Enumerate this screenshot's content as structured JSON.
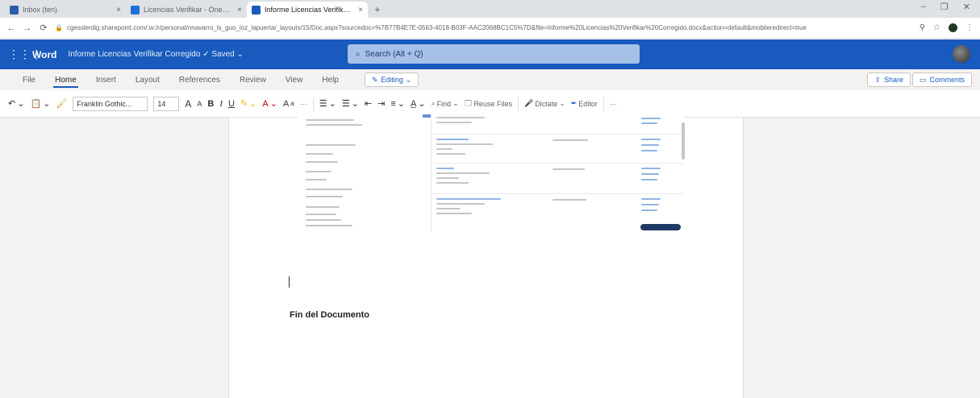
{
  "browser": {
    "tabs": [
      {
        "title": "Inbox (ten)",
        "favicon_color": "#2a5caa",
        "active": false
      },
      {
        "title": "Licencias Verifikar - OneDrive",
        "favicon_color": "#1f6fd4",
        "active": false
      },
      {
        "title": "Informe Licencias Verifikar - Co...",
        "favicon_color": "#185abd",
        "active": true
      }
    ],
    "new_tab_label": "+",
    "url": "cgesslerdig.sharepoint.com/:w:/r/personal/nnavarro_ls_guo_loz_lapuerta/_layouts/15/Doc.aspx?sourcedoc=%7B77B4E7E-0563-4018-B03F-AAC2068BC1C5%7D&file=Informe%20Licencias%20Verifikar%20Corregido.docx&action=default&mobileredirect=true"
  },
  "app": {
    "name": "Word",
    "doc_title": "Informe Licencias Verifikar  Corregido  ✓  Saved  ⌄",
    "search_placeholder": "Search (Alt + Q)",
    "brand_color": "#185abd"
  },
  "ribbon": {
    "tabs": [
      "File",
      "Home",
      "Insert",
      "Layout",
      "References",
      "Review",
      "View",
      "Help"
    ],
    "active_tab": "Home",
    "editing_label": "Editing ⌄",
    "share_label": "Share",
    "comments_label": "Comments"
  },
  "toolbar": {
    "font_name": "Franklin Gothic...",
    "font_size": "14",
    "grow_font": "A",
    "shrink_font": "A",
    "bold": "B",
    "italic": "I",
    "underline": "U",
    "find_label": "Find",
    "reuse_files_label": "Reuse Files",
    "dictate_label": "Dictate",
    "editor_label": "Editor",
    "more": "···"
  },
  "document": {
    "end_text": "Fin del Documento"
  }
}
